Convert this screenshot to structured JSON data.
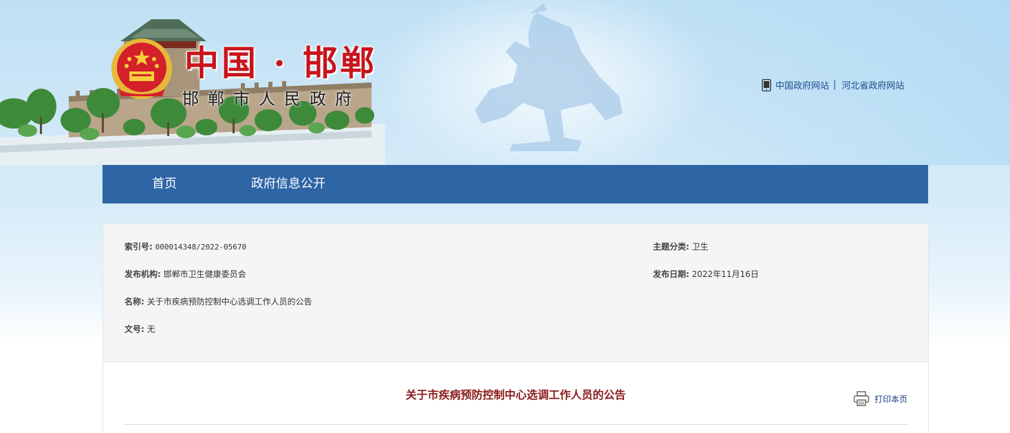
{
  "header": {
    "site_title": "中国 · 邯郸",
    "site_subtitle": "邯郸市人民政府",
    "links": [
      {
        "label": "中国政府网站"
      },
      {
        "label": "河北省政府网站"
      }
    ],
    "separator": "|"
  },
  "nav": {
    "items": [
      {
        "label": "首页"
      },
      {
        "label": "政府信息公开"
      }
    ]
  },
  "info": {
    "index_no": {
      "label": "索引号:",
      "value": "000014348/2022-05670"
    },
    "topic": {
      "label": "主题分类:",
      "value": "卫生"
    },
    "publisher": {
      "label": "发布机构:",
      "value": "邯郸市卫生健康委员会"
    },
    "publish_date": {
      "label": "发布日期:",
      "value": "2022年11月16日"
    },
    "name": {
      "label": "名称:",
      "value": "关于市疾病预防控制中心选调工作人员的公告"
    },
    "doc_no": {
      "label": "文号:",
      "value": "无"
    }
  },
  "article": {
    "title": "关于市疾病预防控制中心选调工作人员的公告",
    "print_label": "打印本页"
  },
  "colors": {
    "nav_bg": "#2d65a5",
    "title_red": "#c8141b",
    "article_title": "#8b1a1a",
    "link_blue": "#1a4c8a"
  }
}
